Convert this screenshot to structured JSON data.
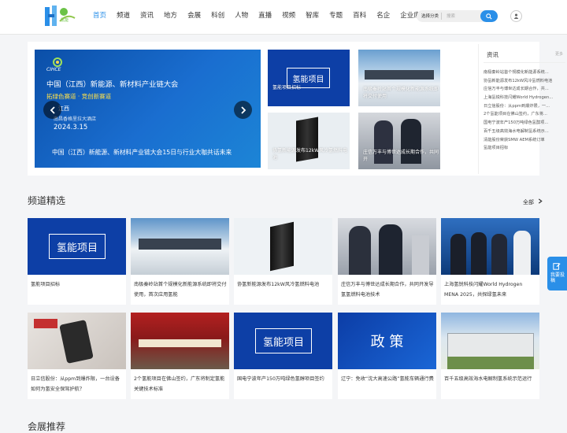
{
  "header": {
    "logo_text": "氢能",
    "nav": [
      "首页",
      "频道",
      "资讯",
      "地方",
      "会展",
      "科创",
      "人物",
      "直播",
      "视频",
      "智库",
      "专题",
      "百科",
      "名企",
      "企业库"
    ],
    "active_index": 0,
    "search_category": "选择分类",
    "search_placeholder": "搜索"
  },
  "banner": {
    "slide": {
      "badge": "CIHCE",
      "title": "中国（江西）新能源、新材料产业链大会",
      "subtitle": "拓绿色赛道 · 竞创新赛道",
      "location": "江西",
      "venue": "南昌香格里拉大酒店",
      "date": "2024.3.15",
      "caption": "中国（江西）新能源、新材料产业链大会15日与行业大咖共话未来"
    },
    "thumbs": [
      {
        "caption": "氢能项目招标",
        "box_text": "氢能项目"
      },
      {
        "caption": "南极秦岭站首个规模化新能源系统即将交付使用"
      },
      {
        "caption": "协氢新能源发布12kW风冷氢燃料电池"
      },
      {
        "caption": "庄信万丰与博世达成长期合作，共同开"
      }
    ]
  },
  "news": {
    "title": "资讯",
    "more": "更多",
    "items": [
      "南极秦岭站首个规模化新能源系统...",
      "协氢新能源发布12kW风冷氢燃料电池",
      "庄信万丰与博世达成长期合作，共...",
      "上海氢锐科技闪耀World Hydrogen...",
      "日立信股份：从ppm到爆炸限，一...",
      "2个氢能项目在佛山签约，广东将...",
      "国电宁波年产150万吨绿色氢醇项...",
      "百千五级高效海水电解制氢系统示...",
      "清能股份荣获SMW AEM系统订单",
      "氢能项目招标"
    ]
  },
  "section": {
    "title": "频道精选",
    "all": "全部"
  },
  "cards": [
    {
      "title": "氢能项目招标",
      "box_text": "氢能项目"
    },
    {
      "title": "南极秦岭站首个规模化新能源系统即将交付使用，首次应用氢能"
    },
    {
      "title": "协氢新能源发布12kW风冷氢燃料电池"
    },
    {
      "title": "庄信万丰与博世达成长期合作，共同开发导氢氢燃料电池技术"
    },
    {
      "title": "上海氢锐科技闪耀World Hydrogen MENA 2025，共探绿氢未来"
    },
    {
      "title": "日立信股份：从ppm到爆炸限，一台设备如何为氢安全保驾护航？"
    },
    {
      "title": "2个氢能项目在佛山签约，广东将制定氢能关键技术标准"
    },
    {
      "title": "国电宁波年产150万吨绿色氢醇项目签约",
      "box_text": "氢能项目"
    },
    {
      "title": "辽宁：免收“沈大高速公路”氢能车辆通行费",
      "box_text": "政 策"
    },
    {
      "title": "百千五级高效海水电解制氢系统示范运行"
    }
  ],
  "float_button": "我要投稿",
  "bottom_section": "会展推荐",
  "colors": {
    "accent": "#2a8fe8",
    "banner_blue": "#0b4fa8",
    "text": "#333333"
  }
}
